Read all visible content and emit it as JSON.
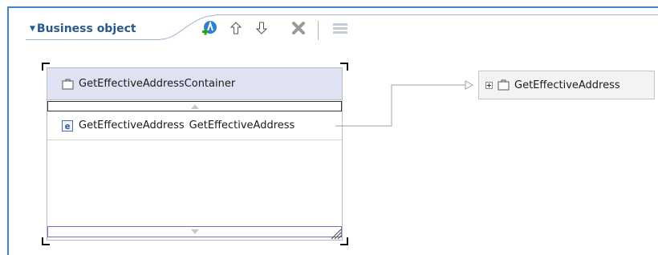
{
  "section": {
    "title": "Business object",
    "collapse_icon": "triangle-down-icon"
  },
  "toolbar": {
    "items": [
      {
        "name": "add-business-object-button",
        "icon": "add-object-icon",
        "tooltip": ""
      },
      {
        "name": "move-up-button",
        "icon": "arrow-up-icon"
      },
      {
        "name": "move-down-button",
        "icon": "arrow-down-icon"
      },
      {
        "name": "delete-button",
        "icon": "delete-x-icon"
      },
      {
        "name": "layout-button",
        "icon": "list-layout-icon"
      }
    ]
  },
  "container": {
    "title": "GetEffectiveAddressContainer",
    "icon": "business-object-icon",
    "fields": [
      {
        "kind_label": "e",
        "name": "GetEffectiveAddress",
        "type": "GetEffectiveAddress"
      }
    ]
  },
  "target": {
    "title": "GetEffectiveAddress",
    "icon": "business-object-icon",
    "expand_icon": "expand-plus-icon"
  },
  "colors": {
    "frame_border": "#3f86c8",
    "container_header": "#dfe2f2",
    "section_title": "#2a5a8a",
    "connector": "#a0a0a0"
  }
}
